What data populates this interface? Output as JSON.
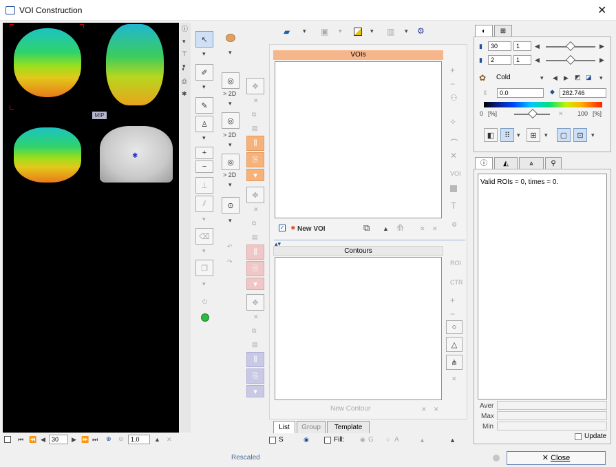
{
  "window": {
    "title": "VOI Construction",
    "close_glyph": "✕"
  },
  "viewer": {
    "mip_label": "MIP"
  },
  "tools": {
    "to_2d_labels": [
      "> 2D",
      "> 2D",
      "> 2D"
    ],
    "plus": "+",
    "minus": "−"
  },
  "voi_panel": {
    "header": "VOIs",
    "new_voi_label": "New VOI",
    "contours_header": "Contours",
    "new_contour_label": "New Contour",
    "tabs": [
      "List",
      "Group",
      "Template"
    ],
    "fill_label": "Fill:",
    "s_label": "S",
    "g_label": "G",
    "a_label": "A"
  },
  "right_tools": {
    "voi_label": "VOI",
    "roi_label": "ROI",
    "ctr_label": "CTR",
    "text_tool": "T"
  },
  "display": {
    "slice_value": "30",
    "slice_step": "1",
    "frame_value": "2",
    "frame_step": "1",
    "colortable": "Cold",
    "min_value": "0.0",
    "max_value": "282.746",
    "range_min_label": "0",
    "range_max_label": "100",
    "range_unit": "[%]"
  },
  "info": {
    "message": "Valid ROIs = 0, times = 0.",
    "stats_labels": [
      "Aver",
      "Max",
      "Min"
    ],
    "update_label": "Update"
  },
  "bottom": {
    "slice_field": "30",
    "zoom_field": "1.0",
    "status": "Rescaled",
    "close_label": "Close"
  },
  "colors": {
    "accent_orange": "#f5b27a",
    "accent_pink": "#f0c6c6",
    "accent_lavender": "#c9c9e6",
    "header_orange": "#f7b68a"
  }
}
